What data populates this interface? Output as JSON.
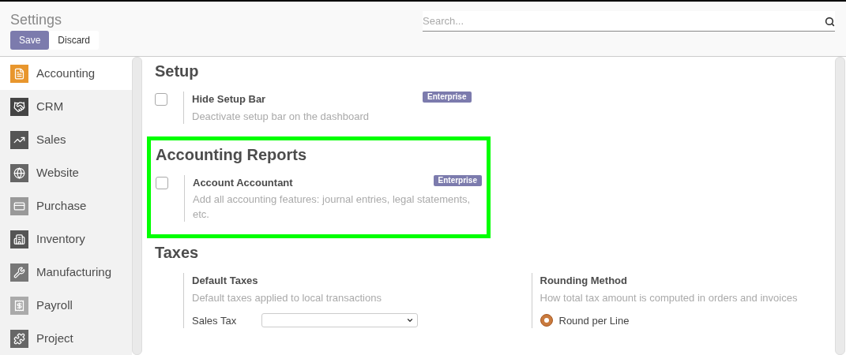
{
  "header": {
    "title": "Settings",
    "buttons": [
      {
        "label": "Save",
        "kind": "primary"
      },
      {
        "label": "Discard",
        "kind": "secondary"
      }
    ],
    "search": {
      "placeholder": "Search..."
    }
  },
  "sidebar": {
    "items": [
      {
        "label": "Accounting",
        "selected": true
      },
      {
        "label": "CRM",
        "selected": false
      },
      {
        "label": "Sales",
        "selected": false
      },
      {
        "label": "Website",
        "selected": false
      },
      {
        "label": "Purchase",
        "selected": false
      },
      {
        "label": "Inventory",
        "selected": false
      },
      {
        "label": "Manufacturing",
        "selected": false
      },
      {
        "label": "Payroll",
        "selected": false
      },
      {
        "label": "Project",
        "selected": false
      }
    ]
  },
  "sections": [
    {
      "title": "Setup",
      "highlighted": false,
      "settings": [
        {
          "kind": "checkbox",
          "title": "Hide Setup Bar",
          "description": "Deactivate setup bar on the dashboard",
          "checked": false,
          "badge": "Enterprise"
        }
      ]
    },
    {
      "title": "Accounting Reports",
      "highlighted": true,
      "settings": [
        {
          "kind": "checkbox",
          "title": "Account Accountant",
          "description": "Add all accounting features: journal entries, legal statements, etc.",
          "checked": false,
          "badge": "Enterprise"
        }
      ]
    },
    {
      "title": "Taxes",
      "highlighted": false,
      "settings": [
        {
          "kind": "select",
          "title": "Default Taxes",
          "description": "Default taxes applied to local transactions",
          "field_label": "Sales Tax"
        },
        {
          "kind": "radio",
          "title": "Rounding Method",
          "description": "How total tax amount is computed in orders and invoices",
          "options": [
            {
              "label": "Round per Line",
              "selected": true
            }
          ]
        }
      ]
    }
  ]
}
